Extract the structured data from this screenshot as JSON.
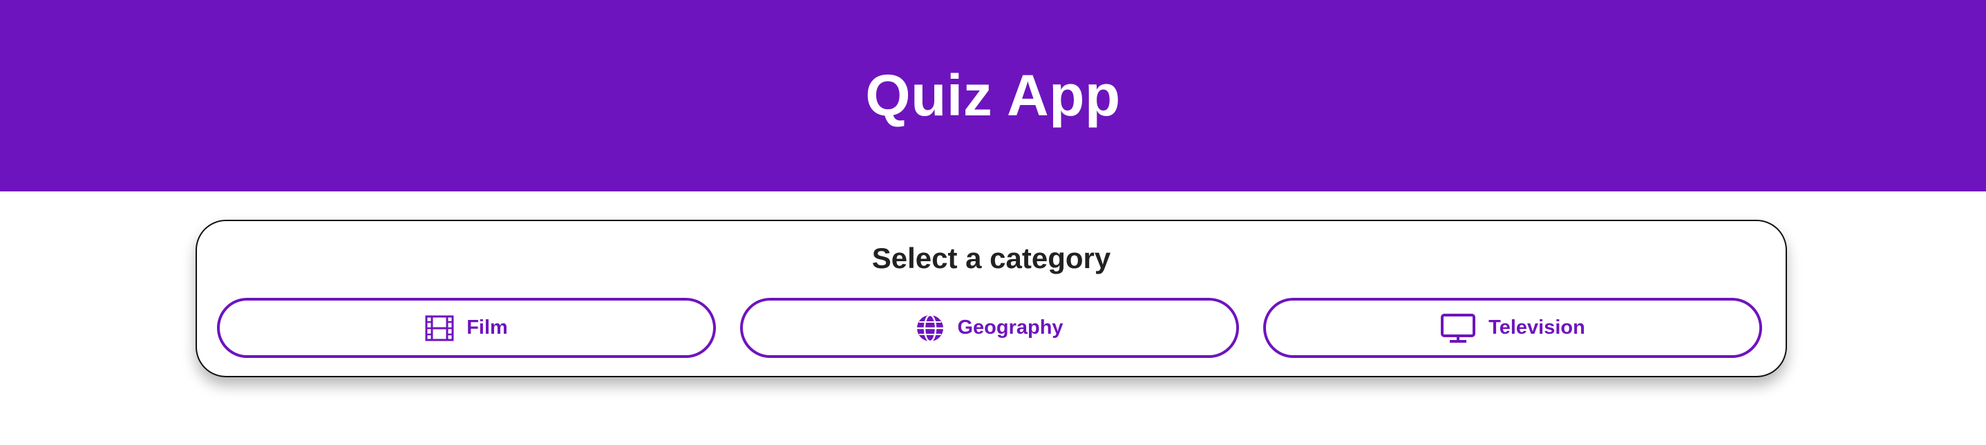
{
  "header": {
    "title": "Quiz App"
  },
  "category_panel": {
    "title": "Select a category",
    "categories": [
      {
        "label": "Film",
        "icon": "film-icon"
      },
      {
        "label": "Geography",
        "icon": "globe-icon"
      },
      {
        "label": "Television",
        "icon": "tv-icon"
      }
    ]
  },
  "colors": {
    "brand": "#6e14be",
    "background": "#ffffff",
    "text": "#222222"
  }
}
